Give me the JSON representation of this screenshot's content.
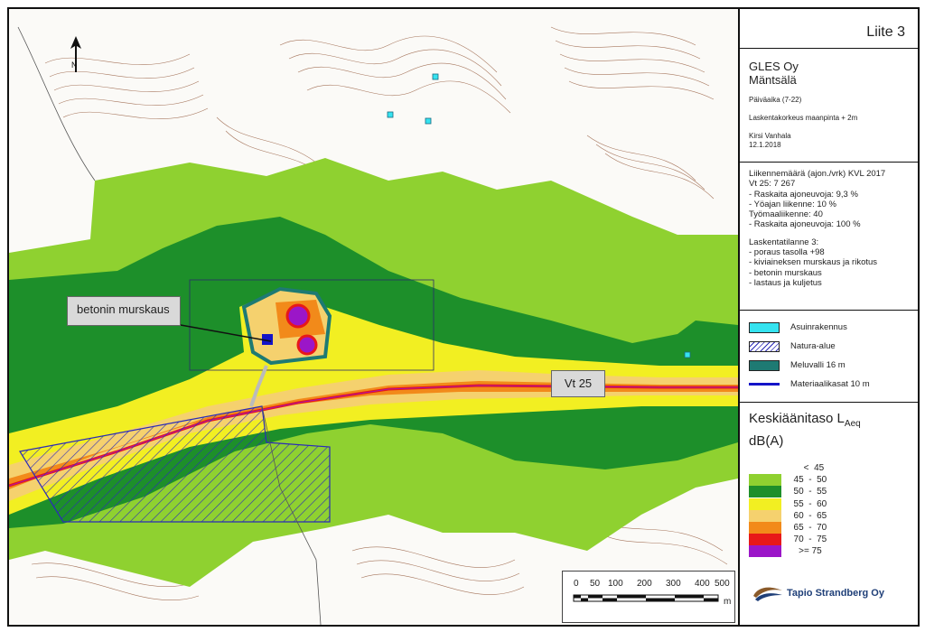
{
  "title": {
    "liite": "Liite 3"
  },
  "info": {
    "company": "GLES Oy",
    "place": "Mäntsälä",
    "period": "Päiväaika (7-22)",
    "calc_height": "Laskentakorkeus maanpinta + 2m",
    "author": "Kirsi Vanhala",
    "date": "12.1.2018"
  },
  "traffic": {
    "lines": [
      "Liikennemäärä (ajon./vrk) KVL 2017",
      "Vt 25: 7 267",
      "- Raskaita ajoneuvoja: 9,3 %",
      "- Yöajan liikenne: 10 %",
      "Työmaaliikenne: 40",
      "- Raskaita ajoneuvoja: 100 %"
    ],
    "scenario_lines": [
      "Laskentatilanne 3:",
      "- poraus tasolla +98",
      "- kiviaineksen murskaus ja rikotus",
      "- betonin murskaus",
      "- lastaus ja kuljetus"
    ]
  },
  "legend": [
    {
      "label": "Asuinrakennus",
      "color": "#35e3f0"
    },
    {
      "label": "Natura-alue",
      "color": "#2b2bb8"
    },
    {
      "label": "Meluvalli 16 m",
      "color": "#1e7a73"
    },
    {
      "label": "Materiaalikasat 10 m",
      "color": "#1414c8"
    }
  ],
  "noise_legend": {
    "title": "Keskiäänitaso L",
    "title_sub": "Aeq",
    "unit": "dB(A)",
    "classes": [
      {
        "label": "      <  45",
        "color": "#ffffff"
      },
      {
        "label": "  45  -  50",
        "color": "#8fd130"
      },
      {
        "label": "  50  -  55",
        "color": "#1d8f2a"
      },
      {
        "label": "  55  -  60",
        "color": "#f2ef22"
      },
      {
        "label": "  60  -  65",
        "color": "#f5d16e"
      },
      {
        "label": "  65  -  70",
        "color": "#f28a1a"
      },
      {
        "label": "  70  -  75",
        "color": "#e81818"
      },
      {
        "label": "    >= 75",
        "color": "#9b16c8"
      }
    ]
  },
  "map_labels": {
    "callout": "betonin murskaus",
    "road": "Vt 25"
  },
  "scale": {
    "ticks": [
      "0",
      "50",
      "100",
      "200",
      "300",
      "400",
      "500"
    ],
    "unit": "m"
  },
  "logo": {
    "text": "Tapio Strandberg Oy"
  }
}
